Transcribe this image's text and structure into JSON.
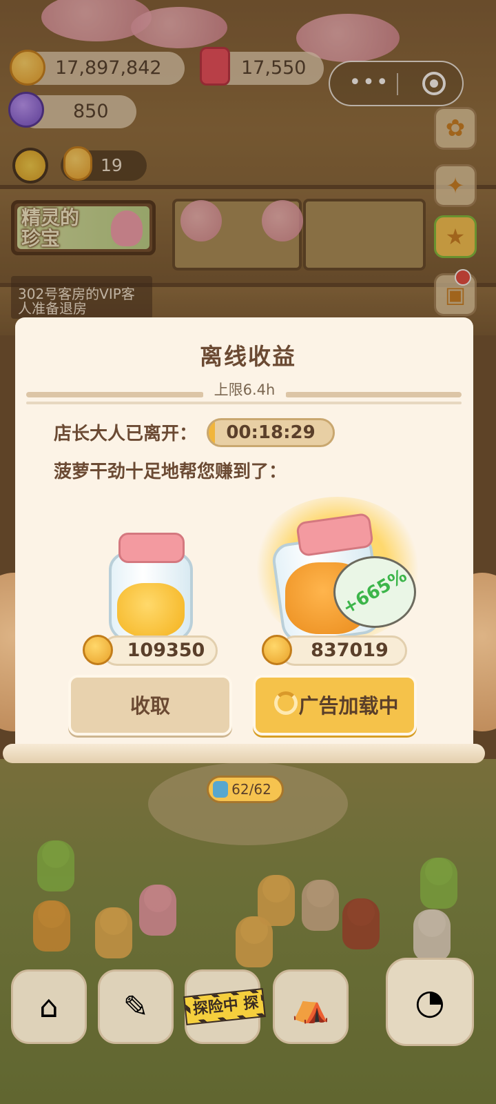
{
  "hud": {
    "coins": "17,897,842",
    "gems": "17,550",
    "crystals": "850",
    "staff_count": "19",
    "coin_icon": "gingerbread-coin-icon",
    "gem_icon": "red-gem-icon",
    "crystal_icon": "purple-candy-icon"
  },
  "capsule": {
    "menu_glyph": "•••"
  },
  "banner": {
    "title": "精灵的珍宝"
  },
  "notice": {
    "text": "302号客房的VIP客人准备退房"
  },
  "popup": {
    "title": "离线收益",
    "cap_label": "上限6.4h",
    "away_label": "店长大人已离开：",
    "away_time": "00:18:29",
    "away_progress": 0.05,
    "earn_label": "菠萝干劲十足地帮您赚到了：",
    "normal_amount": "109350",
    "boosted_amount": "837019",
    "bonus": "+665%",
    "collect_label": "收取",
    "ad_label": "广告加载中"
  },
  "energy": {
    "value": "62/62"
  },
  "bottom_nav": {
    "explore_label": "探险中 探"
  },
  "colors": {
    "accent": "#f5c24a",
    "paper": "#fcf3e6",
    "text_brown": "#6b4a33",
    "bonus_green": "#3cb54a"
  }
}
